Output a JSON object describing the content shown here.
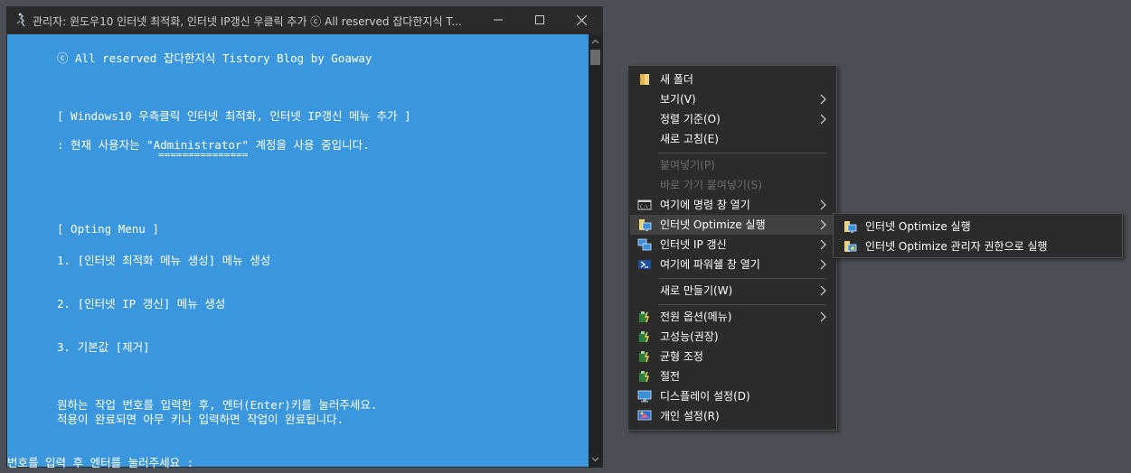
{
  "window": {
    "title": "관리자:  윈도우10 인터넷 최적화, 인터넷 IP갱신 우클릭 추가 ⓒ All reserved 잡다한지식 T..."
  },
  "console": {
    "lines": [
      "ⓒ All reserved 잡다한지식 Tistory Blog by Goaway",
      "[ Windows10 우측클릭 인터넷 최적화, 인터넷 IP갱신 메뉴 추가 ]",
      ": 현재 사용자는 \"Administrator\" 계정을 사용 중입니다.",
      "===============",
      "[ Opting Menu ]",
      "1. [인터넷 최적화 메뉴 생성] 메뉴 생성",
      "2. [인터넷 IP 갱신] 메뉴 생성",
      "3. 기본값 [제거]",
      "원하는 작업 번호를 입력한 후, 엔터(Enter)키를 눌러주세요.",
      "적용이 완료되면 아무 키나 입력하면 작업이 완료됩니다.",
      "번호를 입력 후 엔터를 눌러주세요 :"
    ]
  },
  "menu": {
    "items": [
      {
        "label": "새 폴더",
        "icon": "folder-icon"
      },
      {
        "label": "보기(V)",
        "icon": ""
      },
      {
        "label": "정렬 기준(O)",
        "icon": ""
      },
      {
        "label": "새로 고침(E)",
        "icon": ""
      },
      {
        "label": "붙여넣기(P)",
        "icon": ""
      },
      {
        "label": "바로 가기 붙여넣기(S)",
        "icon": ""
      },
      {
        "label": "여기에 명령 창 열기",
        "icon": "cmd-icon"
      },
      {
        "label": "인터넷 Optimize 실행",
        "icon": "network-icon"
      },
      {
        "label": "인터넷 IP 갱신",
        "icon": "network-icon"
      },
      {
        "label": "여기에 파워쉘 창 열기",
        "icon": "powershell-icon"
      },
      {
        "label": "새로 만들기(W)",
        "icon": ""
      },
      {
        "label": "전원 옵션(메뉴)",
        "icon": "power-plan-icon"
      },
      {
        "label": "고성능(권장)",
        "icon": "power-plan-icon"
      },
      {
        "label": "균형 조정",
        "icon": "power-plan-icon"
      },
      {
        "label": "절전",
        "icon": "power-plan-icon"
      },
      {
        "label": "디스플레이 설정(D)",
        "icon": "display-icon"
      },
      {
        "label": "개인 설정(R)",
        "icon": "personalize-icon"
      }
    ]
  },
  "submenu": {
    "items": [
      {
        "label": "인터넷 Optimize 실행",
        "icon": "network-icon"
      },
      {
        "label": "인터넷 Optimize 관리자 권한으로 실행",
        "icon": "network-admin-icon"
      }
    ]
  },
  "colors": {
    "console_bg": "#3a96dd",
    "menu_bg": "#2b2b2b",
    "desktop_bg": "#4b4f55"
  }
}
